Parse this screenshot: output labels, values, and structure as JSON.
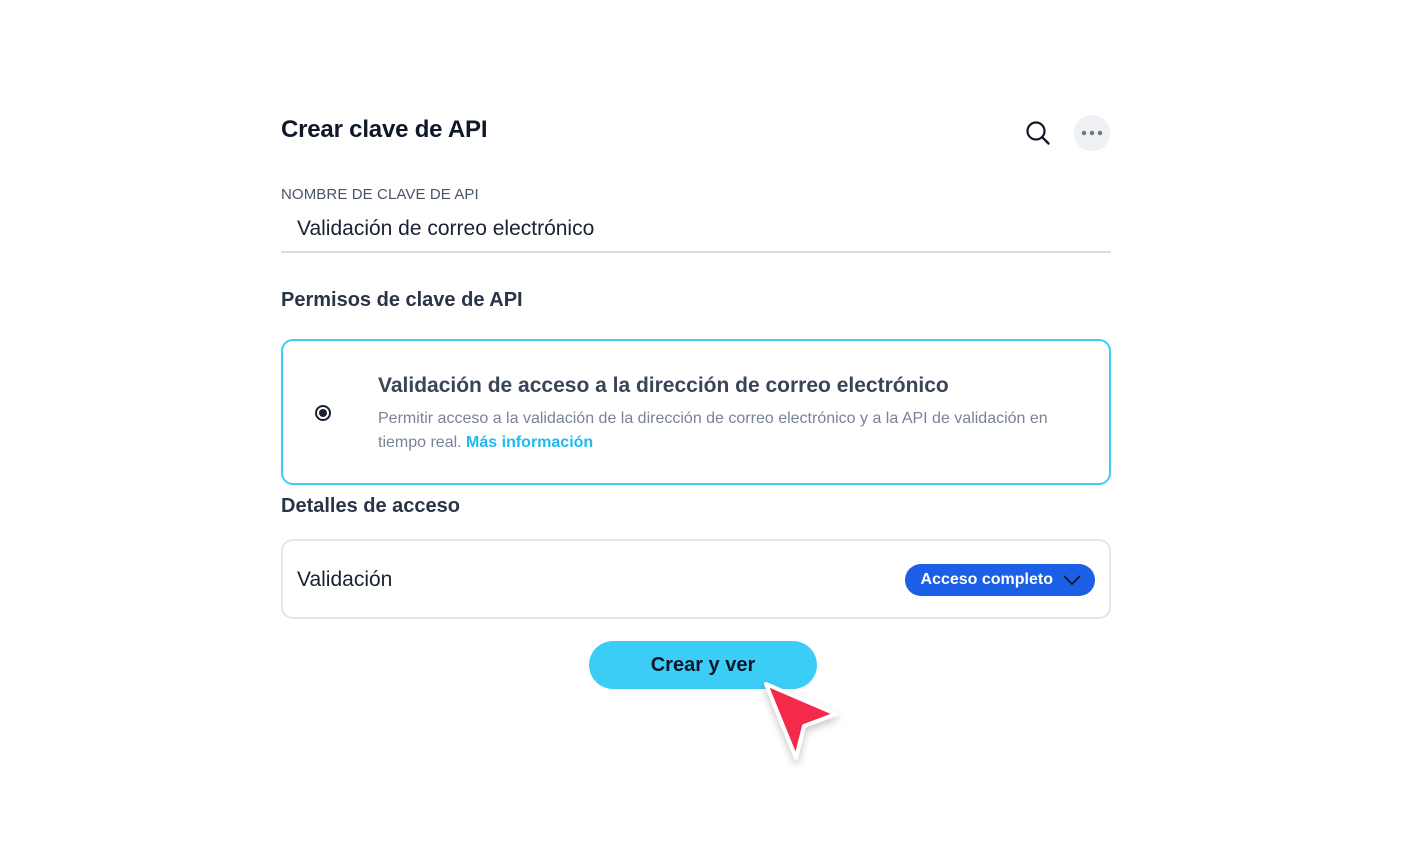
{
  "header": {
    "title": "Crear clave de API",
    "search_icon": "search-icon",
    "more_icon": "more-horizontal-icon"
  },
  "name_field": {
    "label": "NOMBRE DE CLAVE DE API",
    "value": "Validación de correo electrónico"
  },
  "permissions": {
    "section_title": "Permisos de clave de API",
    "option": {
      "selected": true,
      "title": "Validación de acceso a la dirección de correo electrónico",
      "description": "Permitir acceso a la validación de la dirección de correo electrónico y a la API de validación en tiempo real.",
      "link_text": "Más información"
    }
  },
  "access_details": {
    "section_title": "Detalles de acceso",
    "row_label": "Validación",
    "selected_level": "Acceso completo"
  },
  "actions": {
    "create_label": "Crear y ver"
  },
  "colors": {
    "accent_cyan": "#3ccdf6",
    "select_blue": "#1b5fe6",
    "link": "#21b8ef",
    "cursor": "#f42c4c"
  }
}
